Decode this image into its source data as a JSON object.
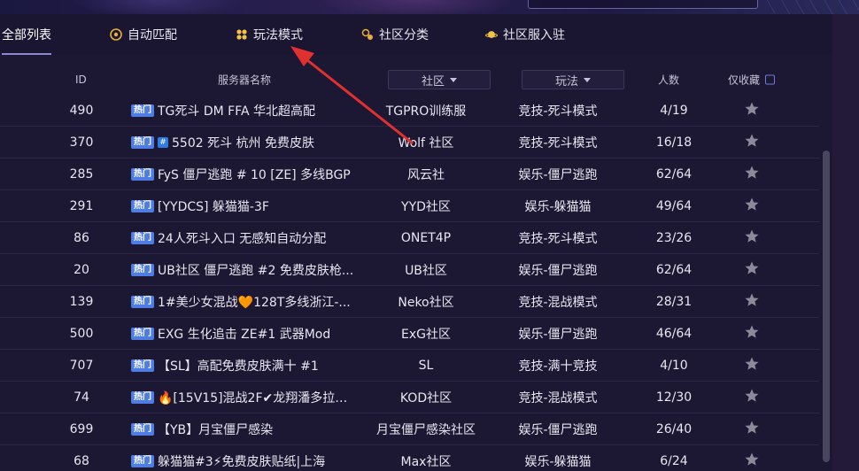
{
  "tabs": [
    {
      "label": "全部列表",
      "icon": "list-icon",
      "active": true
    },
    {
      "label": "自动匹配",
      "icon": "target-icon",
      "active": false
    },
    {
      "label": "玩法模式",
      "icon": "grid-icon",
      "active": false
    },
    {
      "label": "社区分类",
      "icon": "tag-icon",
      "active": false
    },
    {
      "label": "社区服入驻",
      "icon": "planet-icon",
      "active": false
    }
  ],
  "table": {
    "headers": {
      "id": "ID",
      "name": "服务器名称",
      "community": "社区",
      "mode": "玩法",
      "count": "人数",
      "fav": "仅收藏"
    },
    "hot_label": "热门",
    "rows": [
      {
        "id": "490",
        "name": "TG死斗 DM FFA 华北超高配",
        "community": "TGPRO训练服",
        "mode": "竞技-死斗模式",
        "count": "4/19"
      },
      {
        "id": "370",
        "name": "5502 死斗 杭州 免费皮肤",
        "community": "Wolf 社区",
        "mode": "竞技-死斗模式",
        "count": "16/18",
        "prefix": "hash"
      },
      {
        "id": "285",
        "name": "FyS 僵尸逃跑 # 10 [ZE] 多线BGP",
        "community": "风云社",
        "mode": "娱乐-僵尸逃跑",
        "count": "62/64"
      },
      {
        "id": "291",
        "name": "[YYDCS] 躲猫猫-3F",
        "community": "YYD社区",
        "mode": "娱乐-躲猫猫",
        "count": "49/64"
      },
      {
        "id": "86",
        "name": "24人死斗入口 无感知自动分配",
        "community": "ONET4P",
        "mode": "竞技-死斗模式",
        "count": "23/26"
      },
      {
        "id": "20",
        "name": "UB社区 僵尸逃跑 #2 免费皮肤枪...",
        "community": "UB社区",
        "mode": "娱乐-僵尸逃跑",
        "count": "62/64"
      },
      {
        "id": "139",
        "name": "1#美少女混战🧡128T多线浙江-...",
        "community": "Neko社区",
        "mode": "竞技-混战模式",
        "count": "28/31"
      },
      {
        "id": "500",
        "name": "EXG 生化追击 ZE#1 武器Mod",
        "community": "ExG社区",
        "mode": "娱乐-僵尸逃跑",
        "count": "46/64"
      },
      {
        "id": "707",
        "name": "【SL】高配免费皮肤满十 #1",
        "community": "SL",
        "mode": "竞技-满十竞技",
        "count": "4/10"
      },
      {
        "id": "74",
        "name": "🔥[15V15]混战2F✔龙翔潘多拉全...",
        "community": "KOD社区",
        "mode": "竞技-混战模式",
        "count": "12/30"
      },
      {
        "id": "699",
        "name": "【YB】月宝僵尸感染",
        "community": "月宝僵尸感染社区",
        "mode": "娱乐-僵尸逃跑",
        "count": "26/40"
      },
      {
        "id": "68",
        "name": "躲猫猫#3⚡免费皮肤贴纸|上海",
        "community": "Max社区",
        "mode": "娱乐-躲猫猫",
        "count": "6/24"
      }
    ]
  },
  "colors": {
    "background": "#1c1833",
    "hot_badge": "#4f7de3",
    "arrow": "#e0312f",
    "star": "#8c8a99"
  }
}
